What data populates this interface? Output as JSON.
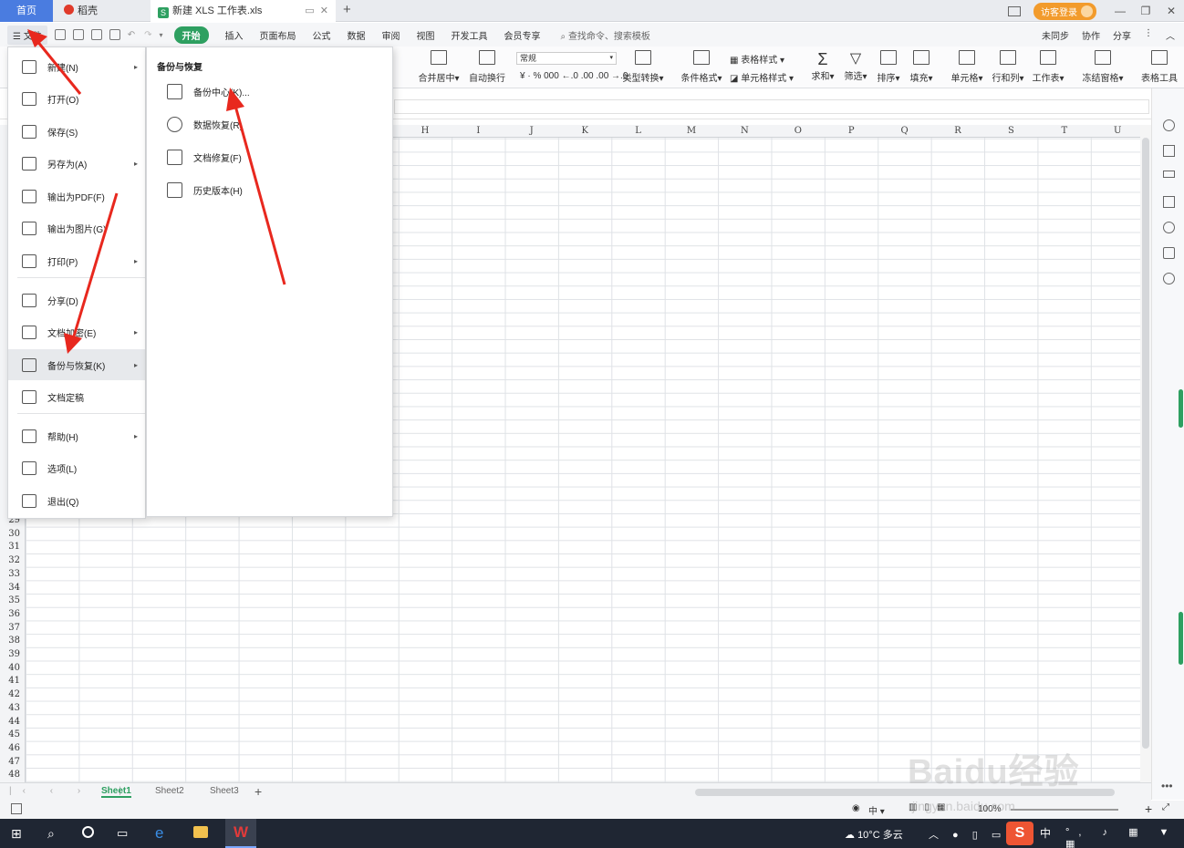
{
  "tabs": {
    "home": "首页",
    "docer": "稻壳",
    "doc_name": "新建 XLS 工作表.xls",
    "add": "+"
  },
  "window": {
    "login": "访客登录"
  },
  "menubar": {
    "file": "文件",
    "start": "开始",
    "items": [
      "插入",
      "页面布局",
      "公式",
      "数据",
      "审阅",
      "视图",
      "开发工具",
      "会员专享"
    ],
    "search": "查找命令、搜索模板",
    "right": [
      "未同步",
      "协作",
      "分享"
    ]
  },
  "ribbon": {
    "merge": "合并居中",
    "wrap": "自动换行",
    "number_format": "常规",
    "number_symbols": "¥ · %  000  ←.0 .00  .00 →.0",
    "type_convert": "类型转换",
    "cond_format": "条件格式",
    "table_style": "表格样式",
    "cell_style": "单元格样式",
    "sum": "求和",
    "filter": "筛选",
    "sort": "排序",
    "fill": "填充",
    "cell": "单元格",
    "row_col": "行和列",
    "sheet": "工作表",
    "freeze": "冻结窗格",
    "table_tools": "表格工具"
  },
  "columns": [
    "H",
    "I",
    "J",
    "K",
    "L",
    "M",
    "N",
    "O",
    "P",
    "Q",
    "R",
    "S",
    "T",
    "U"
  ],
  "rows": [
    "29",
    "30",
    "31",
    "32",
    "33",
    "34",
    "35",
    "36",
    "37",
    "38",
    "39",
    "40",
    "41",
    "42",
    "43",
    "44",
    "45",
    "46",
    "47",
    "48"
  ],
  "file_menu": {
    "items": [
      {
        "label": "新建(N)",
        "arrow": true
      },
      {
        "label": "打开(O)",
        "arrow": false
      },
      {
        "label": "保存(S)",
        "arrow": false
      },
      {
        "label": "另存为(A)",
        "arrow": true
      },
      {
        "label": "输出为PDF(F)",
        "arrow": false
      },
      {
        "label": "输出为图片(G)",
        "arrow": false
      },
      {
        "label": "打印(P)",
        "arrow": true
      },
      {
        "label": "分享(D)",
        "arrow": false
      },
      {
        "label": "文档加密(E)",
        "arrow": true
      },
      {
        "label": "备份与恢复(K)",
        "arrow": true
      },
      {
        "label": "文档定稿",
        "arrow": false
      },
      {
        "label": "帮助(H)",
        "arrow": true
      },
      {
        "label": "选项(L)",
        "arrow": false
      },
      {
        "label": "退出(Q)",
        "arrow": false
      }
    ]
  },
  "submenu": {
    "title": "备份与恢复",
    "items": [
      "备份中心(K)...",
      "数据恢复(R)",
      "文档修复(F)",
      "历史版本(H)"
    ]
  },
  "sheets": [
    "Sheet1",
    "Sheet2",
    "Sheet3"
  ],
  "status": {
    "zoom": "100%",
    "input_mode": "中"
  },
  "taskbar": {
    "weather": "10°C 多云",
    "ime": "S",
    "ime_lang": "中"
  },
  "watermark": {
    "main": "Baidu经验",
    "sub": "jingyan.baidu.com"
  }
}
